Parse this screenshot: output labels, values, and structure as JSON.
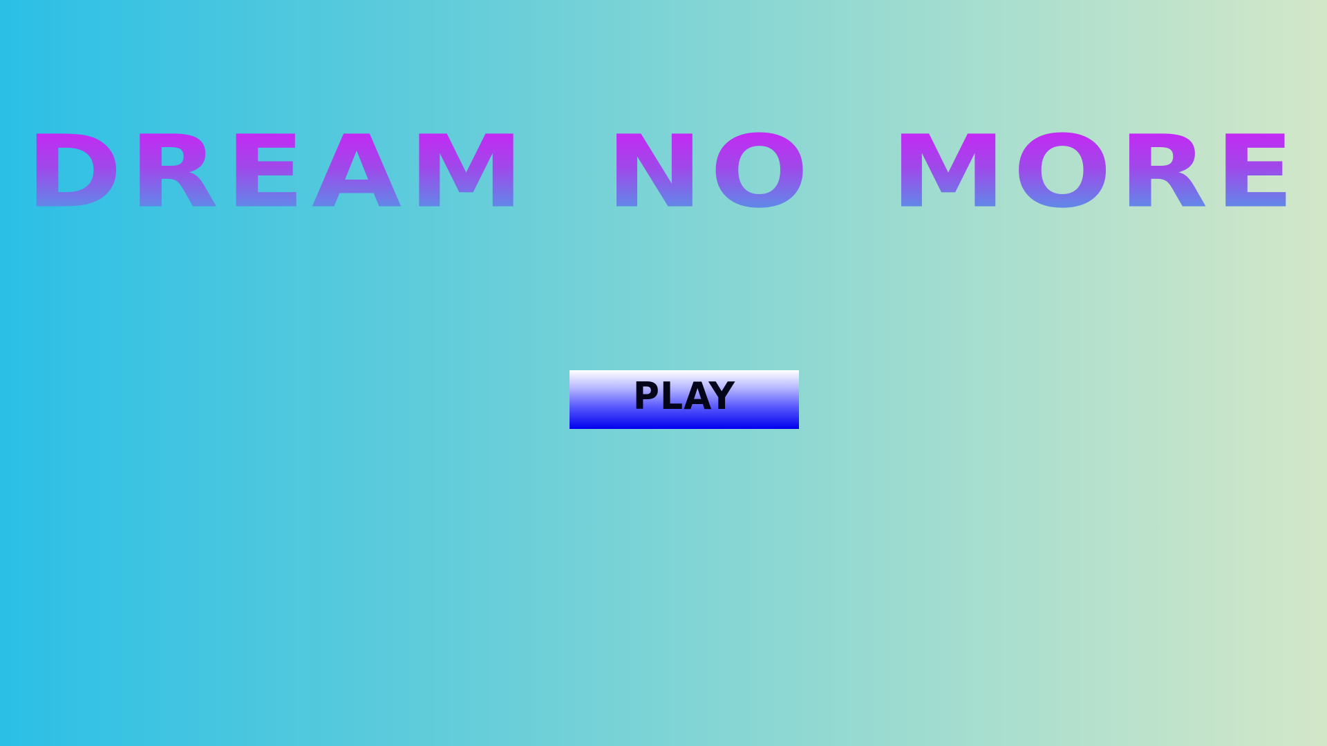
{
  "game": {
    "title": "DREAM NO MORE",
    "play_button_label": "PLAY"
  },
  "colors": {
    "background_left": "#2bbfe6",
    "background_right": "#d3e7c8",
    "title_top": "#cc22f5",
    "title_bottom": "#4e9be6",
    "button_top": "#ffffff",
    "button_bottom": "#0000ee",
    "button_text": "#05051a"
  }
}
